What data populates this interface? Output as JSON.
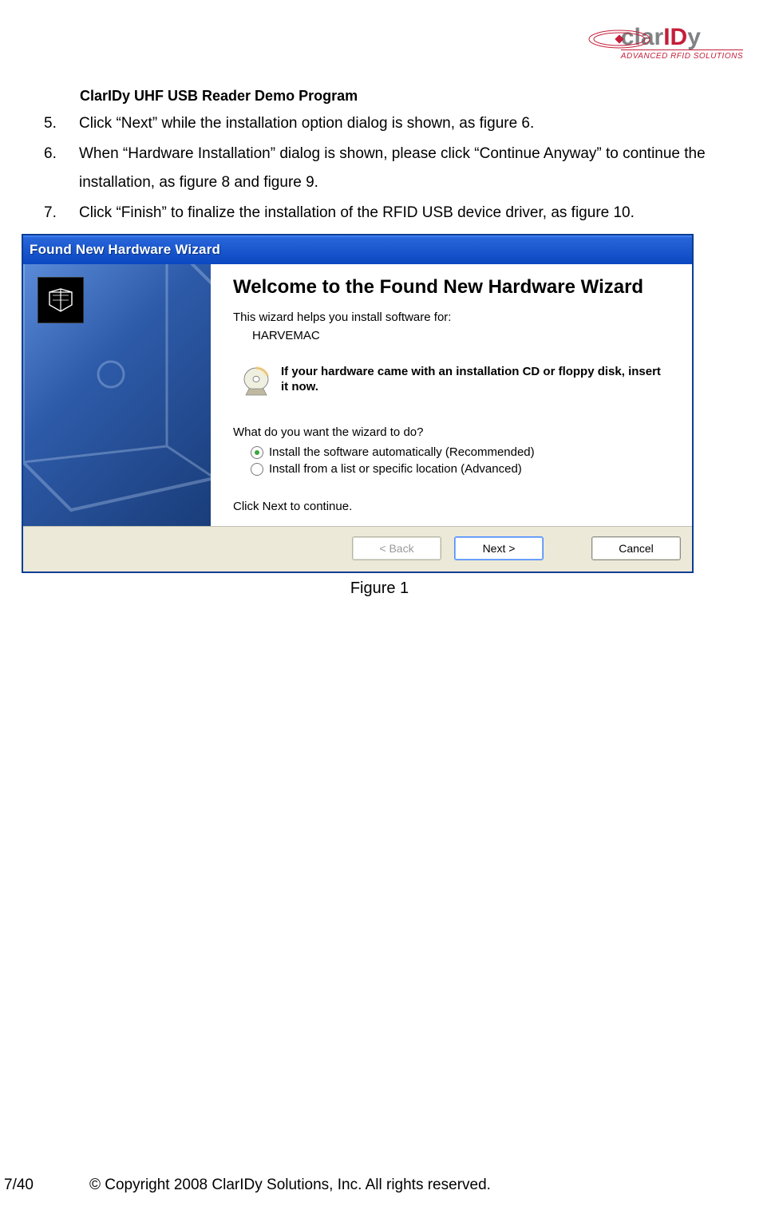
{
  "logo": {
    "text1": "clar",
    "text2": "ID",
    "text3": "y",
    "subtitle": "ADVANCED RFID SOLUTIONS"
  },
  "doc": {
    "title": "ClarIDy UHF USB Reader Demo Program"
  },
  "steps": [
    {
      "num": "5.",
      "text": "Click “Next” while the installation option dialog is shown, as figure 6."
    },
    {
      "num": "6.",
      "text": "When “Hardware Installation” dialog is shown, please click “Continue Anyway” to continue the installation, as figure 8 and figure 9."
    },
    {
      "num": "7.",
      "text": "Click “Finish” to finalize the installation of the RFID USB device driver, as figure 10."
    }
  ],
  "wizard": {
    "titlebar": "Found New Hardware Wizard",
    "welcome": "Welcome to the Found New Hardware Wizard",
    "helps": "This wizard helps you install software for:",
    "device": "HARVEMAC",
    "cd": "If your hardware came with an installation CD or floppy disk, insert it now.",
    "prompt": "What do you want the wizard to do?",
    "opt1": "Install the software automatically (Recommended)",
    "opt2": "Install from a list or specific location (Advanced)",
    "click_next": "Click Next to continue.",
    "back": "< Back",
    "next": "Next >",
    "cancel": "Cancel"
  },
  "figure": "Figure 1",
  "footer": {
    "page": "7/40",
    "copyright": "© Copyright 2008 ClarIDy Solutions, Inc. All rights reserved."
  }
}
